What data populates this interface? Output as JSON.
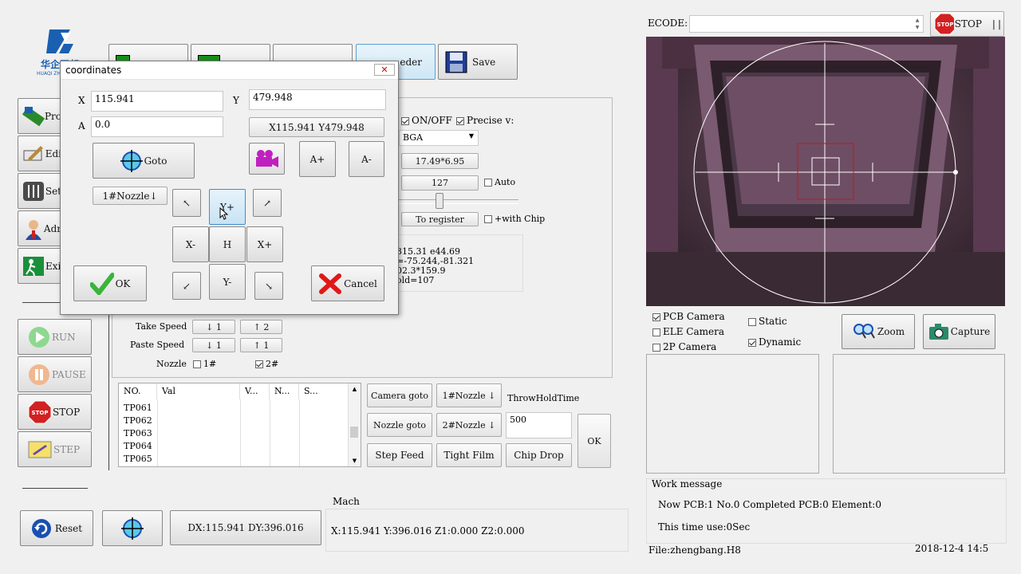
{
  "logo": {
    "brand_cn": "华企正邦",
    "brand_en": "HUAQI ZHE"
  },
  "toolbar": {
    "feeder_label": "eder",
    "save_label": "Save"
  },
  "left_menu": [
    {
      "label": "Pro",
      "icon": "process-icon"
    },
    {
      "label": "Edi",
      "icon": "edit-icon"
    },
    {
      "label": "Set",
      "icon": "settings-icon"
    },
    {
      "label": "Adr",
      "icon": "admin-icon"
    },
    {
      "label": "Exi",
      "icon": "exit-icon"
    }
  ],
  "run_controls": {
    "run": "RUN",
    "pause": "PAUSE",
    "stop": "STOP",
    "step": "STEP"
  },
  "settings": {
    "onoff_label": "ON/OFF",
    "onoff_checked": true,
    "precise_label": "Precise v:",
    "precise_checked": true,
    "package_value": "BGA",
    "size_value": "17.49*6.95",
    "threshold_value": "127",
    "auto_label": "Auto",
    "register_button": "To register",
    "with_chip_label": "+with Chip",
    "result_lines": [
      "315.31 e44.69",
      "=-75.244,-81.321",
      "02.3*159.9",
      "old=107"
    ]
  },
  "speeds": {
    "take_label": "Take Speed",
    "take_down": "↓ 1",
    "take_up": "↑ 2",
    "paste_label": "Paste Speed",
    "paste_down": "↓ 1",
    "paste_up": "↑ 1",
    "nozzle_label": "Nozzle",
    "nozzle1": "1#",
    "nozzle2": "2#"
  },
  "point_table": {
    "headers": [
      "NO.",
      "Val",
      "V...",
      "N...",
      "S..."
    ],
    "rows": [
      "TP061",
      "TP062",
      "TP063",
      "TP064",
      "TP065"
    ]
  },
  "actions": {
    "camera_goto": "Camera goto",
    "nozzle1_select": "1#Nozzle ↓",
    "throw_hold_label": "ThrowHoldTime",
    "throw_hold_value": "500",
    "nozzle_goto": "Nozzle goto",
    "nozzle2_select": "2#Nozzle ↓",
    "ok": "OK",
    "step_feed": "Step Feed",
    "tight_film": "Tight Film",
    "chip_drop": "Chip Drop"
  },
  "bottom_bar": {
    "reset": "Reset",
    "dxdy": "DX:115.941 DY:396.016",
    "mach_label": "Mach",
    "mach_coords": "X:115.941 Y:396.016 Z1:0.000 Z2:0.000"
  },
  "dialog": {
    "title": "coordinates",
    "x_label": "X",
    "x_value": "115.941",
    "y_label": "Y",
    "y_value": "479.948",
    "a_label": "A",
    "a_value": "0.0",
    "xy_button": "X115.941 Y479.948",
    "goto": "Goto",
    "a_plus": "A+",
    "a_minus": "A-",
    "nozzle_select": "1#Nozzle↓",
    "y_plus": "Y+",
    "x_minus": "X-",
    "home": "H",
    "x_plus": "X+",
    "y_minus": "Y-",
    "ok": "OK",
    "cancel": "Cancel"
  },
  "right_panel": {
    "ecode_label": "ECODE:",
    "ecode_value": "",
    "stop_label": "STOP",
    "pcb_camera": "PCB Camera",
    "pcb_checked": true,
    "ele_camera": "ELE Camera",
    "ele_checked": false,
    "twop_camera": "2P Camera",
    "twop_checked": false,
    "static_label": "Static",
    "static_checked": false,
    "dynamic_label": "Dynamic",
    "dynamic_checked": true,
    "zoom": "Zoom",
    "capture": "Capture",
    "work_message_label": "Work message",
    "work_line1": "Now PCB:1 No.0 Completed PCB:0 Element:0",
    "work_line2": "This time use:0Sec",
    "file_label": "File:zhengbang.H8",
    "datetime": "2018-12-4 14:5"
  },
  "colors": {
    "accent_blue": "#2a6fb8",
    "stop_red": "#d32020",
    "ok_green": "#3ab43a",
    "cancel_red": "#e01818"
  }
}
